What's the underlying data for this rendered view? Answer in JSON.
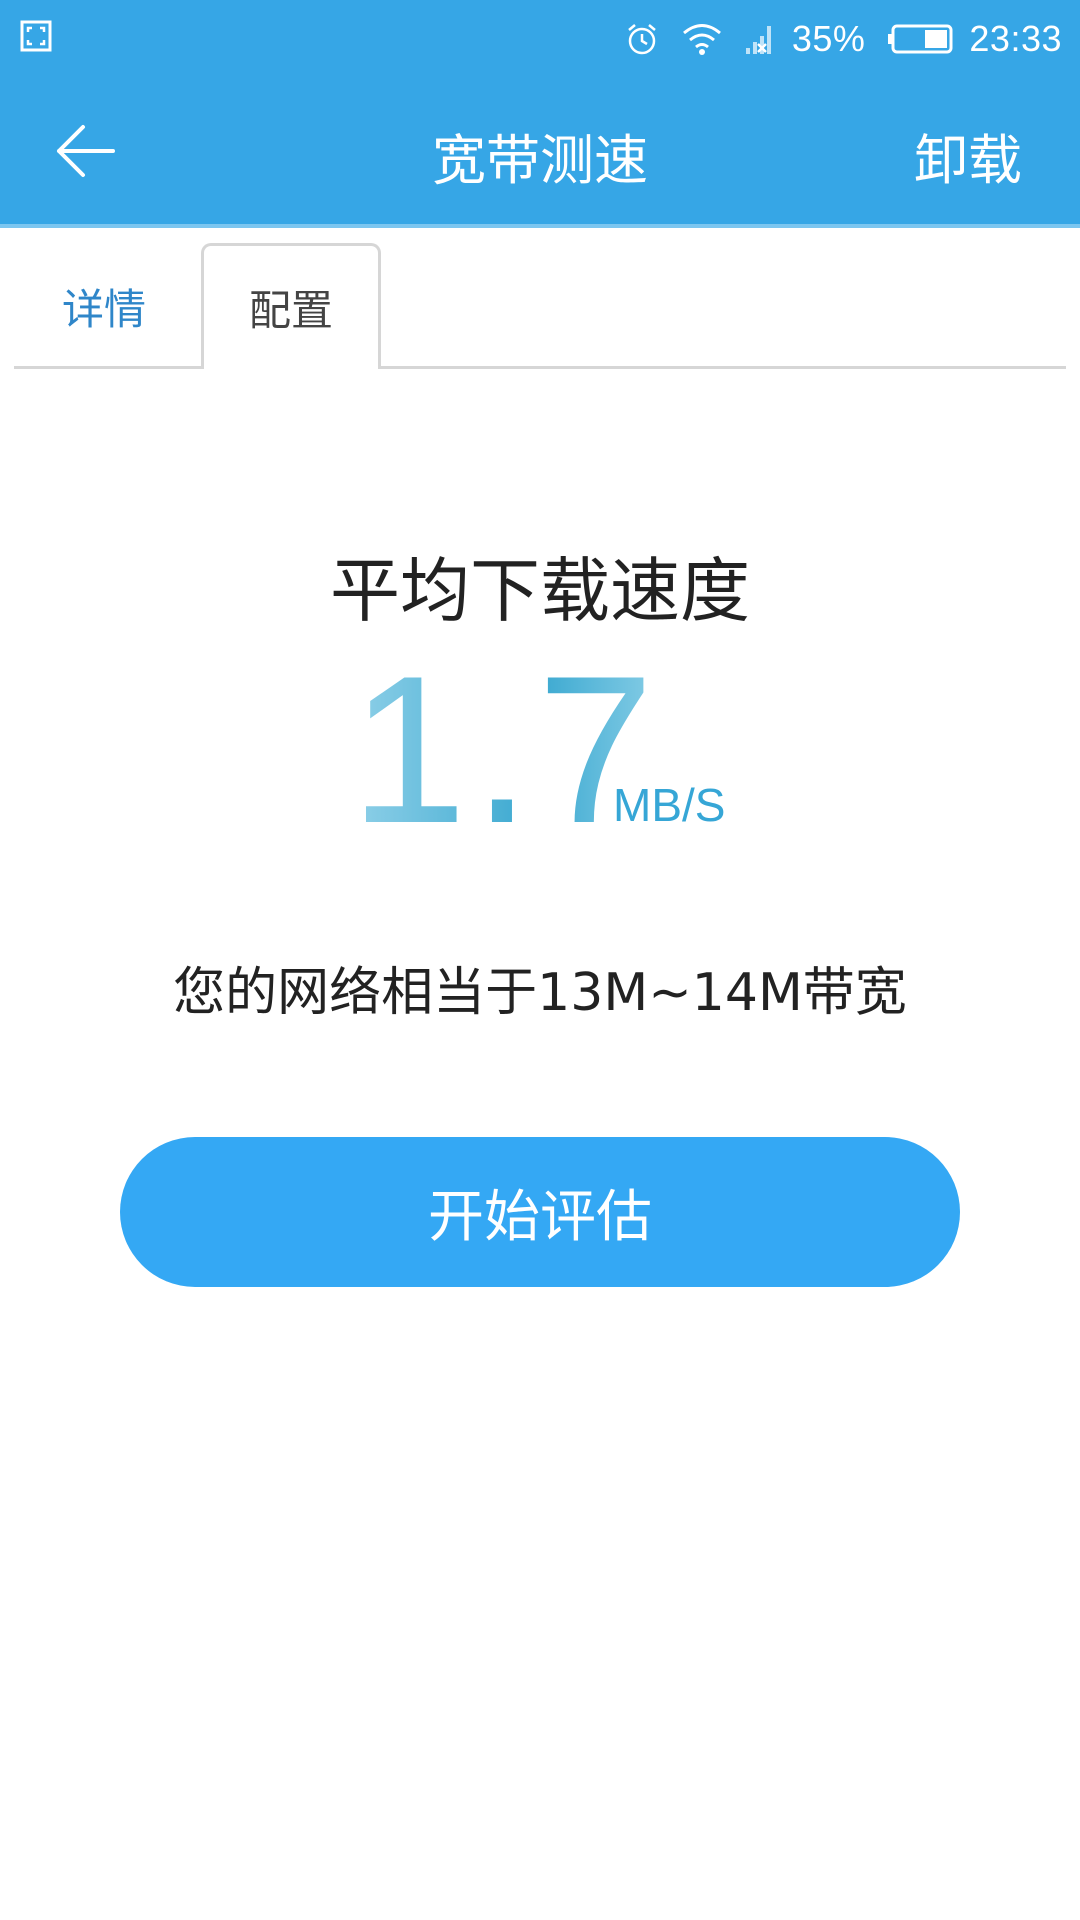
{
  "status_bar": {
    "battery_percent": "35%",
    "time": "23:33",
    "icons": [
      "screenshot-icon",
      "alarm-icon",
      "wifi-icon",
      "signal-off-icon",
      "battery-icon"
    ]
  },
  "app_bar": {
    "title": "宽带测速",
    "action": "卸载",
    "back_icon": "arrow-left-icon"
  },
  "tabs": [
    {
      "label": "详情",
      "active": false
    },
    {
      "label": "配置",
      "active": true
    }
  ],
  "result": {
    "label": "平均下载速度",
    "speed_value": "1.7",
    "speed_unit": "MB/S",
    "bandwidth_text": "您的网络相当于13M~14M带宽"
  },
  "actions": {
    "start_button": "开始评估"
  },
  "colors": {
    "header_blue": "#36a6e6",
    "button_blue": "#34a8f4",
    "tab_active_text": "#2f86c9"
  }
}
